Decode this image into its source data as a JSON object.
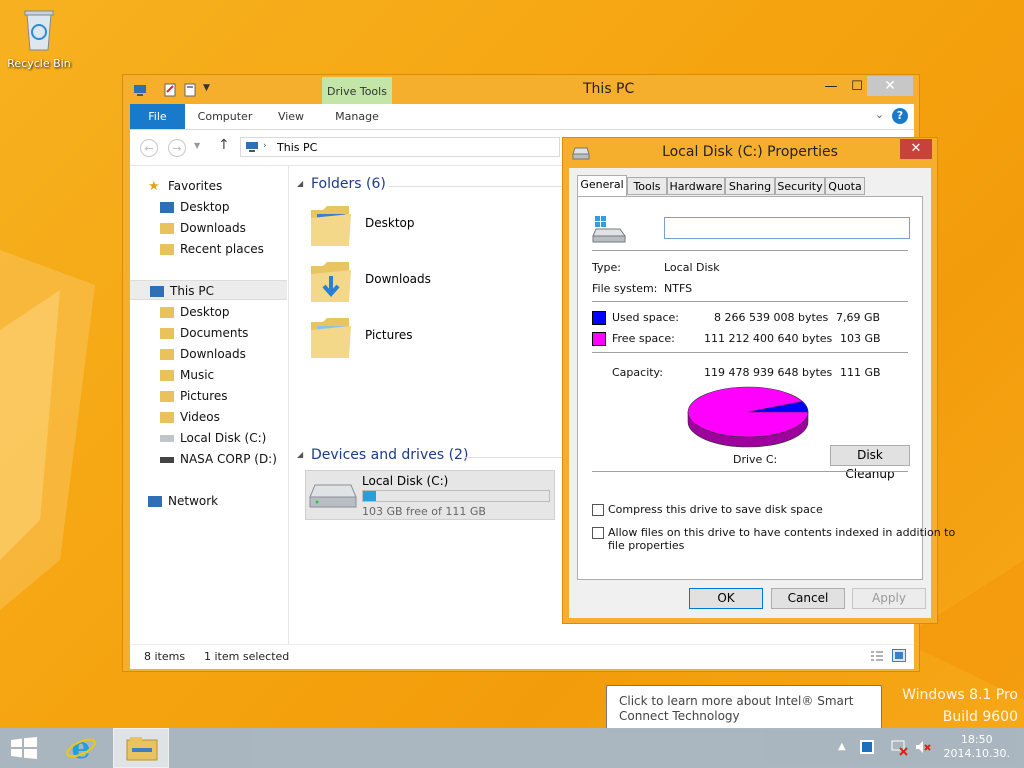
{
  "desktop": {
    "recycle_bin_label": "Recycle Bin",
    "watermark_line1": "Windows 8.1 Pro",
    "watermark_line2": "Build 9600"
  },
  "explorer": {
    "title": "This PC",
    "contextual_tab_group": "Drive Tools",
    "ribbon_tabs": [
      "File",
      "Computer",
      "View",
      "Manage"
    ],
    "address": "This PC",
    "nav": {
      "favorites": "Favorites",
      "favorites_items": [
        "Desktop",
        "Downloads",
        "Recent places"
      ],
      "this_pc": "This PC",
      "this_pc_items": [
        "Desktop",
        "Documents",
        "Downloads",
        "Music",
        "Pictures",
        "Videos",
        "Local Disk (C:)",
        "NASA CORP (D:)"
      ],
      "network": "Network"
    },
    "folders_header": "Folders (6)",
    "folders": [
      "Desktop",
      "Downloads",
      "Pictures"
    ],
    "devices_header": "Devices and drives (2)",
    "drive": {
      "name": "Local Disk (C:)",
      "free_text": "103 GB free of 111 GB",
      "used_fraction": 0.07
    },
    "status": {
      "items": "8 items",
      "selected": "1 item selected"
    }
  },
  "properties": {
    "title": "Local Disk (C:) Properties",
    "tabs": [
      "General",
      "Tools",
      "Hardware",
      "Sharing",
      "Security",
      "Quota"
    ],
    "name_value": "",
    "type_label": "Type:",
    "type_value": "Local Disk",
    "fs_label": "File system:",
    "fs_value": "NTFS",
    "used_label": "Used space:",
    "used_bytes": "8 266 539 008 bytes",
    "used_gb": "7,69 GB",
    "free_label": "Free space:",
    "free_bytes": "111 212 400 640 bytes",
    "free_gb": "103 GB",
    "capacity_label": "Capacity:",
    "capacity_bytes": "119 478 939 648 bytes",
    "capacity_gb": "111 GB",
    "drive_label": "Drive C:",
    "disk_cleanup": "Disk Cleanup",
    "compress_label": "Compress this drive to save disk space",
    "index_label_1": "Allow files on this drive to have contents indexed in addition to",
    "index_label_2": "file properties",
    "compress_checked": false,
    "index_checked": false,
    "ok": "OK",
    "cancel": "Cancel",
    "apply": "Apply",
    "used_color": "#0000ff",
    "free_color": "#ff00ff",
    "used_fraction": 0.0692
  },
  "taskbar": {
    "time": "18:50",
    "date": "2014.10.30.",
    "tooltip": "Click to learn more about Intel® Smart Connect Technology"
  }
}
